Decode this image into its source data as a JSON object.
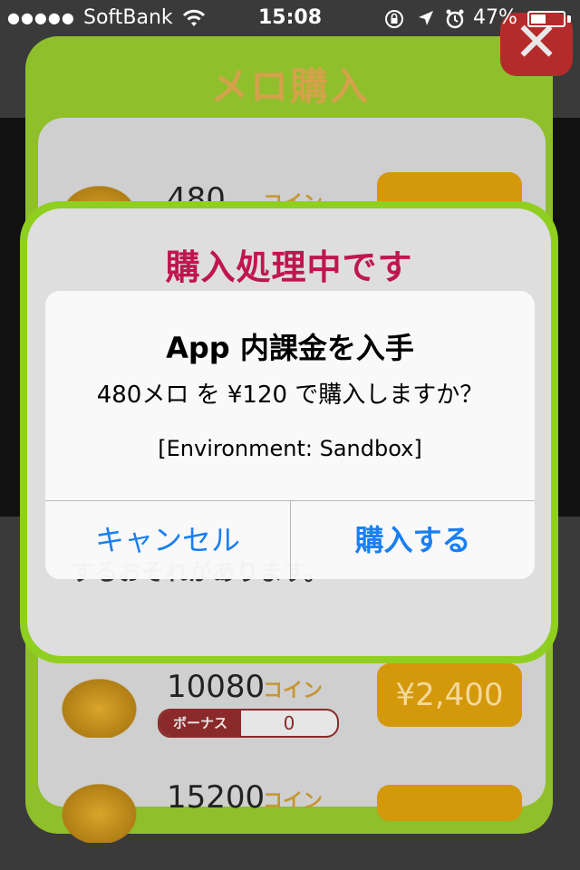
{
  "status_bar": {
    "signal_dots": "●●●●●",
    "carrier": "SoftBank",
    "time": "15:08",
    "battery_percent": "47%"
  },
  "shop": {
    "title": "メロ購入",
    "close_label": "✕",
    "items": [
      {
        "amount": "480",
        "unit": "コイン",
        "price": ""
      },
      {
        "amount": "10080",
        "unit": "コイン",
        "bonus_label": "ボーナス",
        "bonus_value": "0",
        "price": "¥2,400"
      },
      {
        "amount": "15200",
        "unit": "コイン",
        "price": ""
      }
    ]
  },
  "processing_dialog": {
    "title": "購入処理中です",
    "message": "するおそれがあります。"
  },
  "alert": {
    "title": "App 内課金を入手",
    "message": "480メロ を ¥120 で購入しますか？",
    "environment": "[Environment: Sandbox]",
    "cancel_label": "キャンセル",
    "confirm_label": "購入する"
  },
  "colors": {
    "ios_blue": "#1a7ff2",
    "panel_green": "#8fcf1f",
    "title_pink": "#c0164e",
    "coin_gold": "#d4980b"
  }
}
